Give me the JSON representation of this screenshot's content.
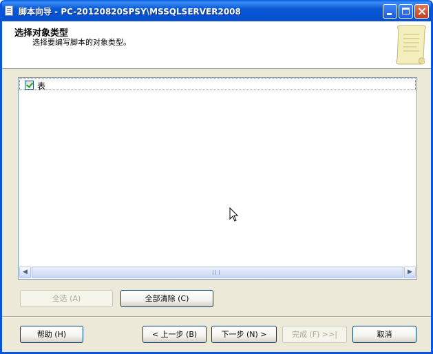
{
  "window": {
    "title": "脚本向导 - PC-20120820SPSY\\MSSQLSERVER2008"
  },
  "header": {
    "title": "选择对象类型",
    "subtitle": "选择要编写脚本的对象类型。"
  },
  "object_types": [
    {
      "label": "表",
      "checked": true
    }
  ],
  "buttons": {
    "select_all": "全选 (A)",
    "clear_all": "全部清除 (C)",
    "help": "帮助 (H)",
    "prev": "< 上一步 (B)",
    "next": "下一步 (N) >",
    "finish": "完成 (F) >>|",
    "cancel": "取消"
  },
  "colors": {
    "title_bar": "#0a5ad8",
    "dialog_bg": "#ece9d8",
    "accent_border": "#003c74"
  }
}
